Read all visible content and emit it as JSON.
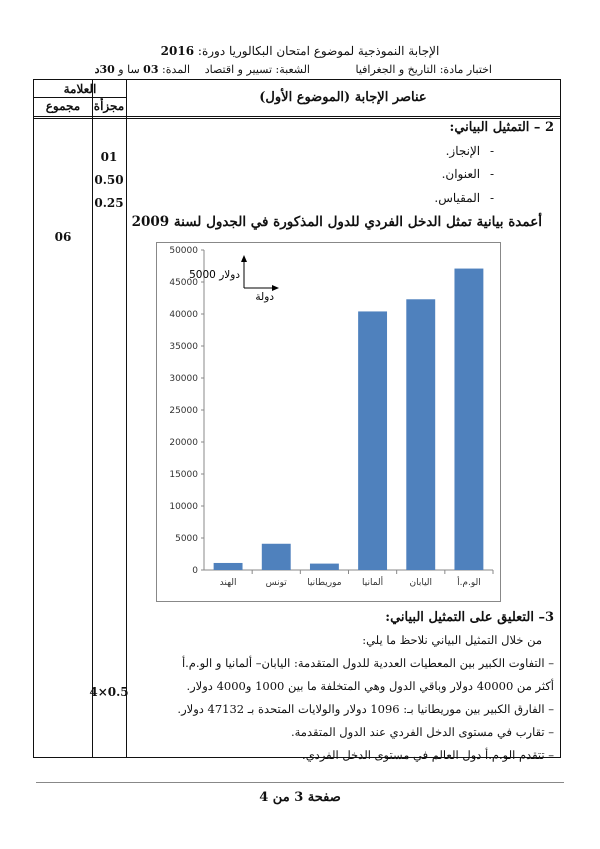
{
  "header": {
    "title_prefix": "الإجابة النموذجية لموضوع امتحان البكالوريا دورة:",
    "year": "2016",
    "subject": "اختبار مادة: التاريخ و الجغرافيا",
    "branch": "الشعبة: تسيير و اقتصاد",
    "duration_prefix": "المدة:",
    "duration_hours": "03",
    "duration_mid": "سا و",
    "duration_minutes": "30د"
  },
  "table_head": {
    "mark": "العلامة",
    "total": "مجموع",
    "partial": "مجزأة",
    "elements": "عناصر الإجابة (الموضوع الأول)"
  },
  "marks": {
    "total": "06",
    "p1": "01",
    "p2": "0.50",
    "p3": "0.25",
    "p4": "4×0.5"
  },
  "section2": {
    "title": "2 – التمثيل البياني:",
    "items": [
      "الإنجاز.",
      "العنوان.",
      "المقياس."
    ],
    "chart_title": "أعمدة بيانية تمثل الدخل الفردي للدول المذكورة في الجدول لسنة 2009"
  },
  "chart_data": {
    "type": "bar",
    "categories": [
      "الهند",
      "تونس",
      "موريطانيا",
      "ألمانيا",
      "اليابان",
      "الو.م.أ"
    ],
    "values": [
      1100,
      4100,
      1000,
      40400,
      42300,
      47100
    ],
    "ylim": [
      0,
      50000
    ],
    "yticks": [
      0,
      5000,
      10000,
      15000,
      20000,
      25000,
      30000,
      35000,
      40000,
      45000,
      50000
    ],
    "grid": false,
    "bar_color": "#4f81bd",
    "scale_y": "5000 دولار",
    "scale_x": "دولة"
  },
  "section3": {
    "title": "3– التعليق على التمثيل البياني:",
    "intro": "من خلال التمثيل البياني نلاحظ ما يلي:",
    "lines": [
      "– التفاوت الكبير بين المعطيات العددية للدول المتقدمة: اليابان– ألمانيا و الو.م.أ",
      "أكثر من 40000 دولار وباقي الدول وهي المتخلفة ما بين 1000 و4000 دولار.",
      "– الفارق الكبير بين موريطانيا بـ: 1096 دولار والولايات المتحدة بـ 47132 دولار.",
      "– تقارب في مستوى الدخل الفردي عند الدول المتقدمة.",
      "– تتقدم الو.م.أ دول العالم في مستوى الدخل الفردي."
    ]
  },
  "footer": {
    "text": "صفحة 3 من 4"
  }
}
